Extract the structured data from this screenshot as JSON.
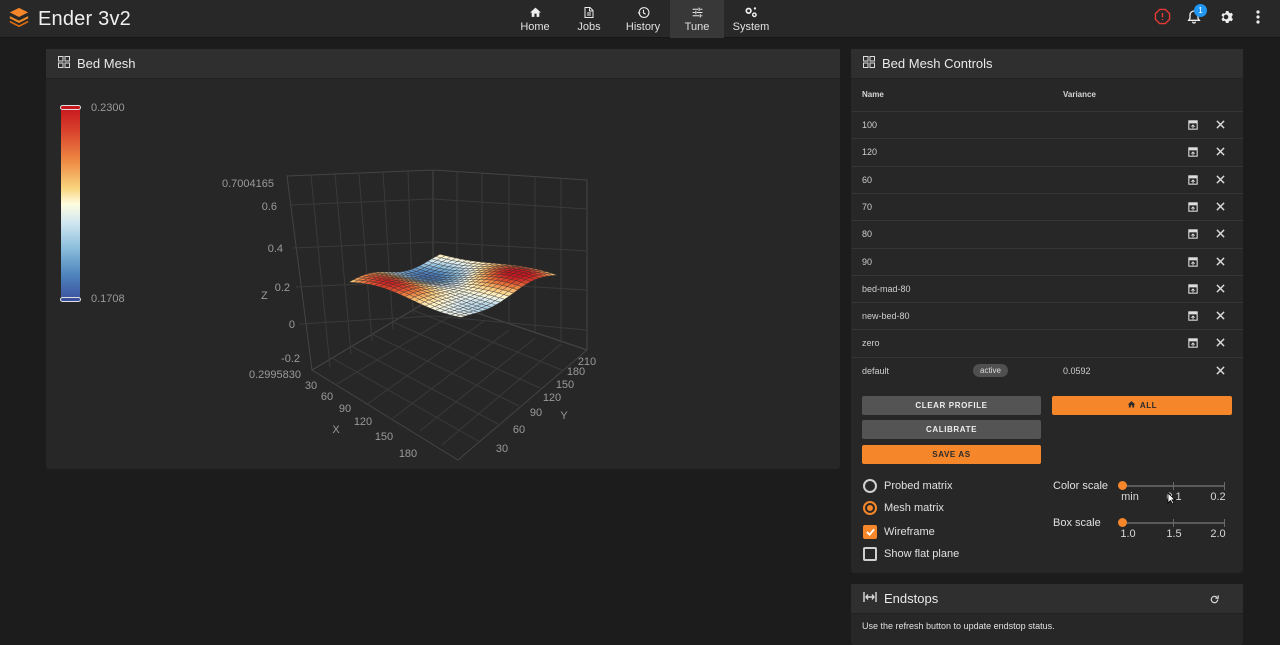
{
  "app": {
    "title": "Ender 3v2"
  },
  "nav": [
    {
      "label": "Home",
      "icon": "home-icon"
    },
    {
      "label": "Jobs",
      "icon": "file-icon"
    },
    {
      "label": "History",
      "icon": "history-icon"
    },
    {
      "label": "Tune",
      "icon": "tune-icon",
      "active": true
    },
    {
      "label": "System",
      "icon": "cogs-icon"
    }
  ],
  "topbar": {
    "notification_count": "1"
  },
  "mesh_panel": {
    "title": "Bed Mesh",
    "legend_max": "0.2300",
    "legend_min": "0.1708",
    "plot": {
      "z_ticks": [
        "0.7004165",
        "0.6",
        "0.4",
        "0.2",
        "0",
        "-0.2",
        "0.2995830"
      ],
      "x_ticks": [
        "30",
        "60",
        "90",
        "120",
        "150",
        "180"
      ],
      "y_ticks": [
        "30",
        "60",
        "90",
        "120",
        "150",
        "180",
        "210"
      ],
      "x_label": "X",
      "y_label": "Y",
      "z_label": "Z"
    }
  },
  "controls": {
    "title": "Bed Mesh Controls",
    "col_name": "Name",
    "col_variance": "Variance",
    "profiles": [
      {
        "name": "100"
      },
      {
        "name": "120"
      },
      {
        "name": "60"
      },
      {
        "name": "70"
      },
      {
        "name": "80"
      },
      {
        "name": "90"
      },
      {
        "name": "bed-mad-80"
      },
      {
        "name": "new-bed-80"
      },
      {
        "name": "zero"
      },
      {
        "name": "default",
        "active_label": "active",
        "variance": "0.0592"
      }
    ],
    "buttons": {
      "clear_profile": "CLEAR PROFILE",
      "calibrate": "CALIBRATE",
      "save_as": "SAVE AS",
      "home_all": "ALL"
    },
    "options": {
      "probed_matrix": "Probed matrix",
      "mesh_matrix": "Mesh matrix",
      "wireframe": "Wireframe",
      "show_flat_plane": "Show flat plane",
      "selected_matrix": "mesh",
      "wireframe_checked": true,
      "flat_plane_checked": false
    },
    "color_scale": {
      "label": "Color scale",
      "ticks": [
        "min",
        "0.1",
        "0.2"
      ],
      "value": "min"
    },
    "box_scale": {
      "label": "Box scale",
      "ticks": [
        "1.0",
        "1.5",
        "2.0"
      ],
      "value": "1.0"
    }
  },
  "endstops": {
    "title": "Endstops",
    "message": "Use the refresh button to update endstop status."
  },
  "colors": {
    "accent": "#f5862a",
    "badge": "#2196f3",
    "alert": "#e53935"
  }
}
